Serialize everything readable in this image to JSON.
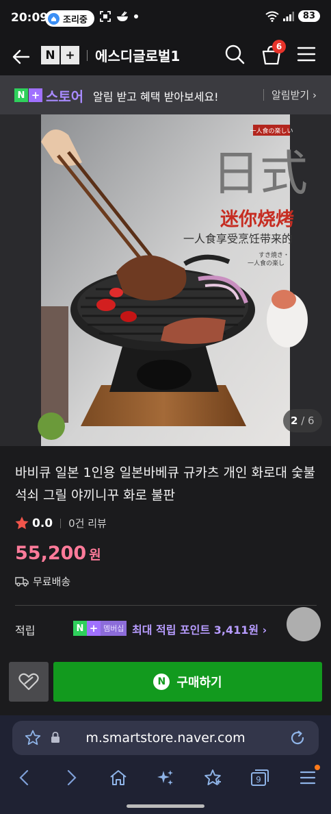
{
  "status_bar": {
    "time": "20:09",
    "cooking_label": "조리중",
    "battery": "83"
  },
  "header": {
    "logo_n": "N",
    "logo_plus": "+",
    "title": "에스디글로벌1",
    "cart_count": "6"
  },
  "store_banner": {
    "logo_n": "N",
    "logo_plus": "+",
    "store_word": "스토어",
    "message": "알림 받고 혜택 받아보세요!",
    "alert_link": "알림받기 ›"
  },
  "product": {
    "image_index": "2",
    "image_total": "/ 6",
    "image_text": {
      "badge": "一人食の楽しい",
      "big_chars": "日式",
      "red_line": "迷你烧烤",
      "sub_line": "一人食享受烹饪带来的",
      "small_1": "すき焼き・",
      "small_2": "一人食の楽し"
    },
    "title": "바비큐 일본 1인용 일본바베큐 규카츠 개인 화로대 숯불 석쇠 그릴 야끼니꾸 화로 불판",
    "rating": "0.0",
    "review_count": "0건 리뷰",
    "price": "55,200",
    "price_unit": "원",
    "shipping": "무료배송",
    "points_label": "적립",
    "points_badge_n": "N",
    "points_badge_plus": "+",
    "points_badge_member": "멤버십",
    "points_text": "최대 적립 포인트 3,411원 ›"
  },
  "buy_bar": {
    "buy_icon": "N",
    "buy_label": "구매하기"
  },
  "browser": {
    "url": "m.smartstore.naver.com",
    "tab_count": "9"
  },
  "colors": {
    "price": "#ff7b9a",
    "buy_button": "#129a1e",
    "naver_green": "#2fd05c",
    "plus_purple": "#a071ff",
    "cart_badge": "#e8332a"
  }
}
